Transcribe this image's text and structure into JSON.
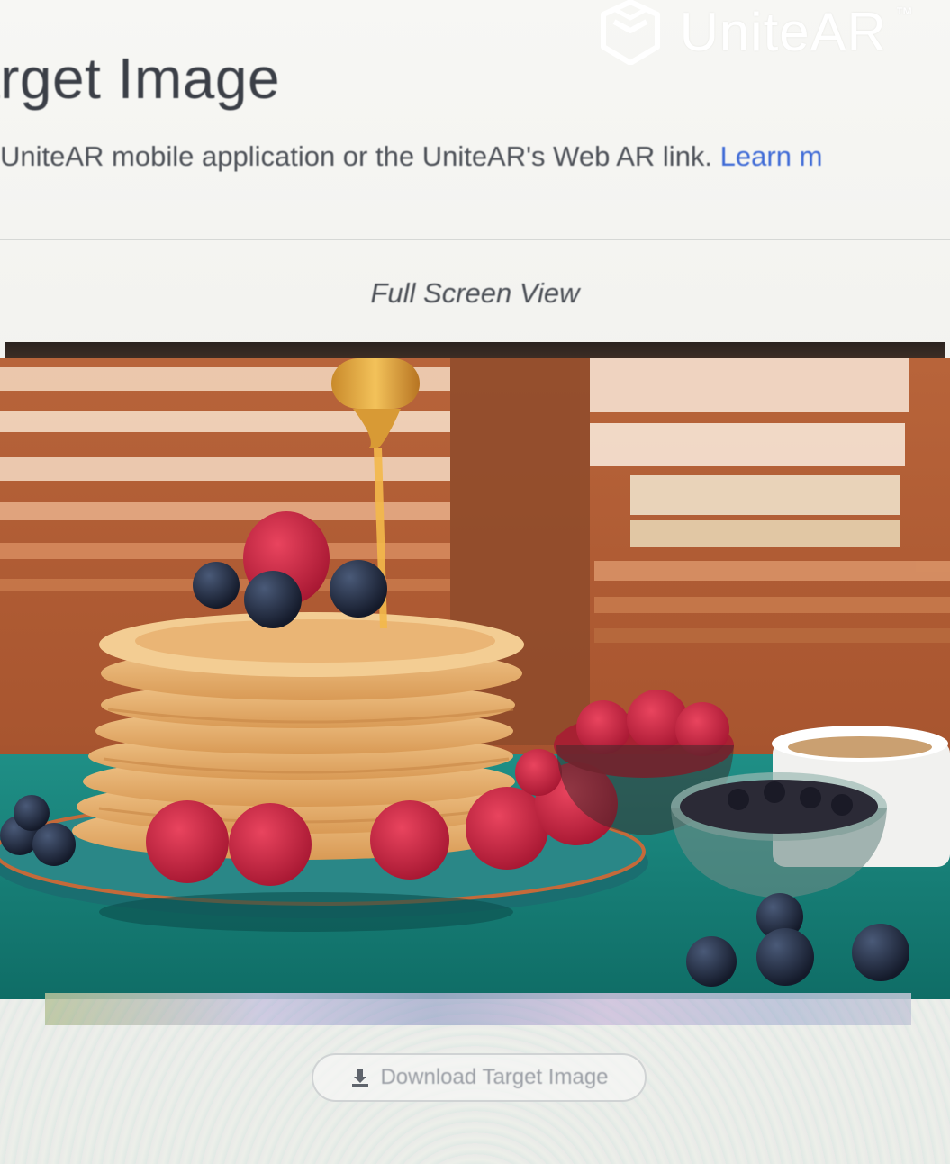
{
  "brand": {
    "name": "UniteAR",
    "trademark": "™",
    "icon": "unitear-logo-icon",
    "color": "#ffffff"
  },
  "header": {
    "title": "arget Image",
    "subtitle": "UniteAR mobile application or the UniteAR's Web AR link.",
    "learn_more": "Learn m"
  },
  "viewer": {
    "full_screen_label": "Full Screen View",
    "image_subject": "pancake-stack-photo"
  },
  "actions": {
    "download_label": "Download Target Image",
    "download_icon": "download-icon"
  },
  "colors": {
    "link": "#3e6ad6",
    "title": "#3b3f47",
    "text": "#4d5158"
  }
}
